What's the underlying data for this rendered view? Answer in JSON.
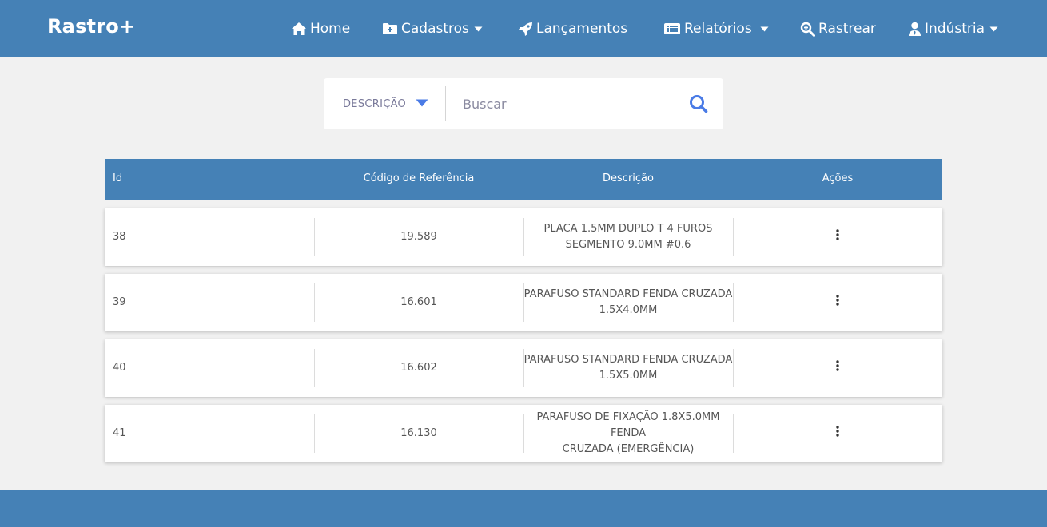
{
  "nav": {
    "brand": "Rastro+",
    "items": [
      {
        "label": "Home",
        "icon": "home-icon"
      },
      {
        "label": "Cadastros",
        "icon": "folder-plus-icon",
        "dropdown": true
      },
      {
        "label": "Lançamentos",
        "icon": "rocket-icon"
      },
      {
        "label": "Relatórios",
        "icon": "list-icon",
        "dropdown": true
      },
      {
        "label": "Rastrear",
        "icon": "search-zoom-icon"
      },
      {
        "label": "Indústria",
        "icon": "user-tie-icon",
        "dropdown": true
      }
    ]
  },
  "search": {
    "filter_label": "DESCRIÇÃO",
    "placeholder": "Buscar",
    "value": ""
  },
  "table": {
    "headers": [
      "Id",
      "Código de Referência",
      "Descrição",
      "Ações"
    ],
    "rows": [
      {
        "id": "38",
        "ref": "19.589",
        "desc1": "PLACA 1.5MM DUPLO T 4 FUROS",
        "desc2": "SEGMENTO 9.0MM #0.6"
      },
      {
        "id": "39",
        "ref": "16.601",
        "desc1": "PARAFUSO STANDARD FENDA CRUZADA",
        "desc2": "1.5X4.0MM"
      },
      {
        "id": "40",
        "ref": "16.602",
        "desc1": "PARAFUSO STANDARD FENDA CRUZADA",
        "desc2": "1.5X5.0MM"
      },
      {
        "id": "41",
        "ref": "16.130",
        "desc1": "PARAFUSO DE FIXAÇÃO 1.8X5.0MM FENDA",
        "desc2": "CRUZADA (EMERGÊNCIA)"
      }
    ]
  },
  "colors": {
    "primary": "#4581b6",
    "background": "#f1f1f1",
    "search_accent": "#4a7be6"
  }
}
